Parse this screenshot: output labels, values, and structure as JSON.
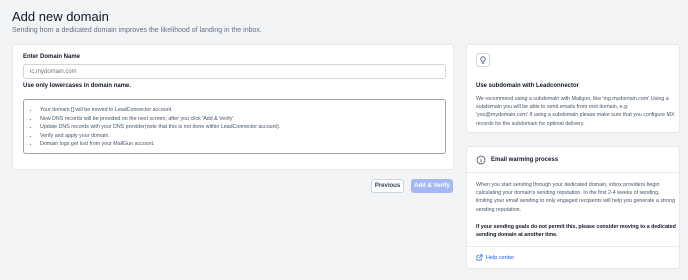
{
  "header": {
    "title": "Add new domain",
    "subtitle": "Sending from a dedicated domain improves the likelihood of landing in the inbox."
  },
  "form": {
    "domain_label": "Enter Domain Name",
    "domain_placeholder": "lc.mydomain.com",
    "hint": "Use only lowercases in domain name.",
    "info_items": [
      "Your domain [] will be moved to LeadConnector account.",
      "New DNS records will be provided on the next screen, after you click 'Add & Verify'",
      "Update DNS records with your DNS provider(note that this is not done within LeadConnector account).",
      "Verify and apply your domain.",
      "Domain logs get lost from your MailGun account."
    ]
  },
  "buttons": {
    "previous": "Previous",
    "add_verify": "Add & Verify"
  },
  "tip_card": {
    "icon": "lightbulb-icon",
    "title": "Use subdomain with Leadconnector",
    "body": "We recommend using a subdomain with Mailgun, like 'mg.mydomain.com' Using a subdomain you will be able to send emails from root domain, e.g: 'you@mydomain.com' If using a subdomain please make sure that you configure MX records for the subdomain for optimal delivery."
  },
  "warming_card": {
    "icon": "info-icon",
    "title": "Email warming process",
    "body": "When you start sending through your dedicated domain, inbox providers begin calculating your domain's sending reputation. In the first 2-4 weeks of sending, limiting your email sending to only engaged recipients will help you generate a strong sending reputation.",
    "note": "If your sending goals do not permit this, please consider moving to a dedicated sending domain at another time.",
    "help_link": "Help center",
    "help_icon": "external-link-icon"
  },
  "colors": {
    "primary_disabled": "#a5b8f5",
    "link": "#155eef",
    "background": "#f3f4f6"
  }
}
